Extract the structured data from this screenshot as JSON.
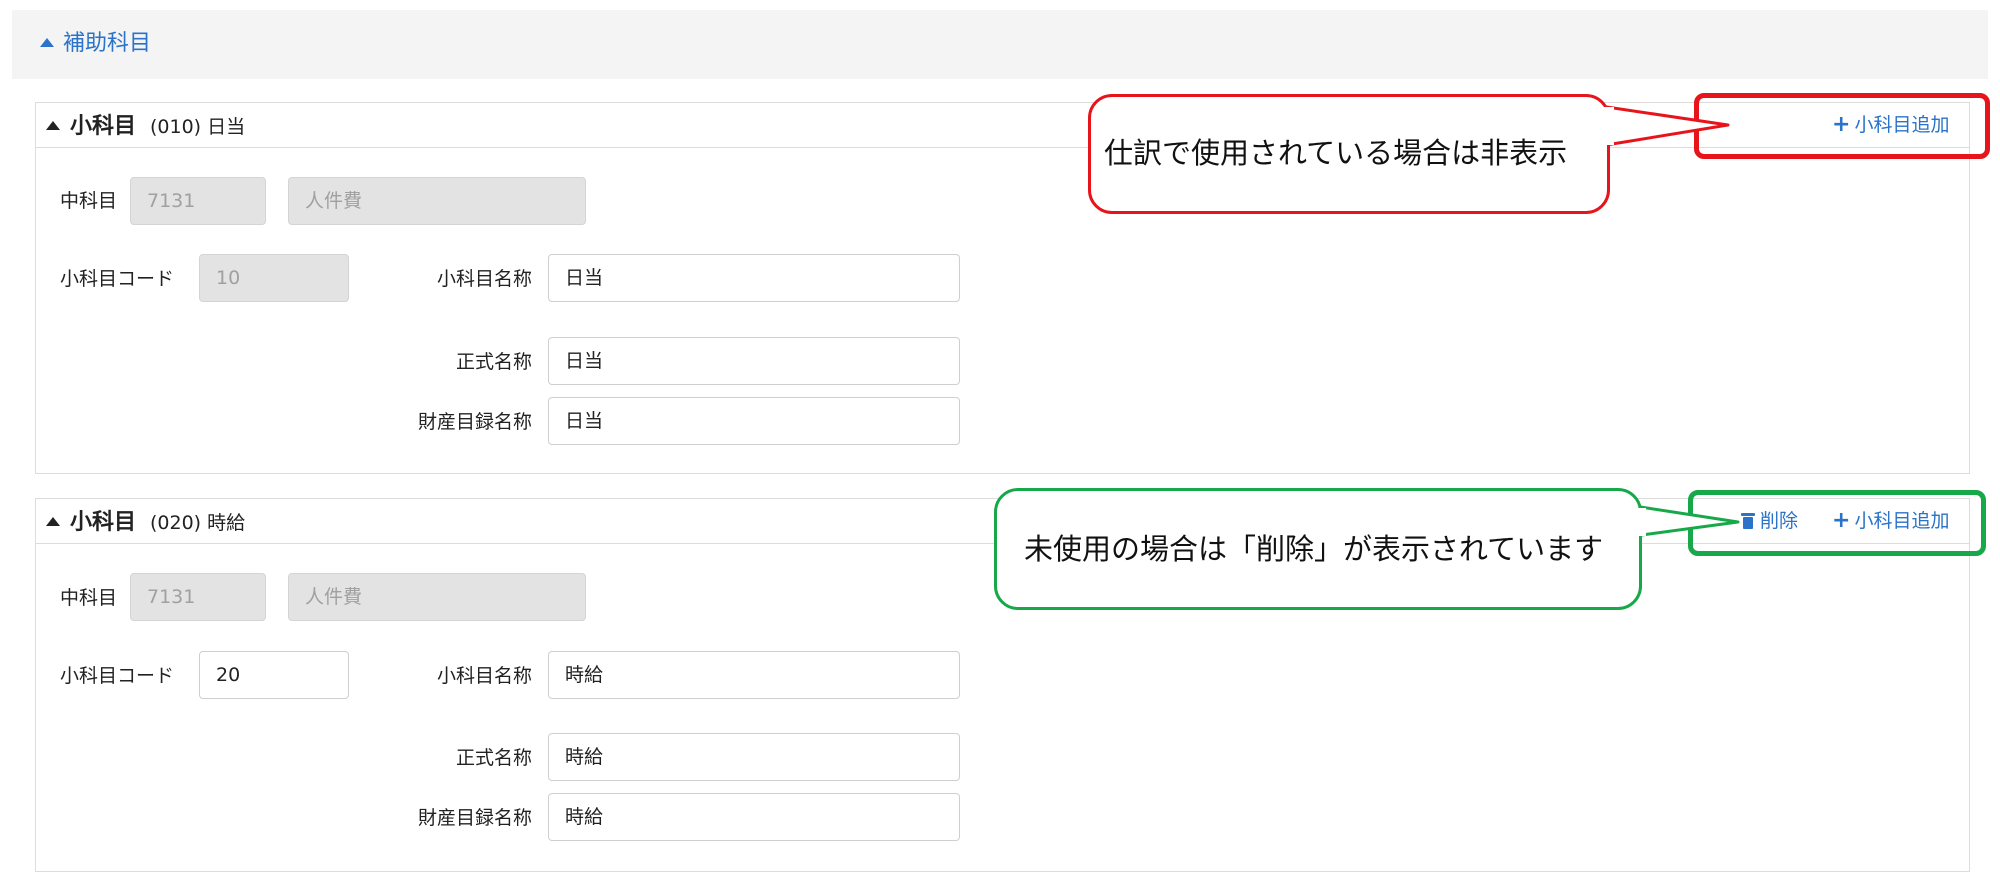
{
  "section": {
    "title": "補助科目"
  },
  "panels": [
    {
      "title": "小科目",
      "subtitle": "(010) 日当",
      "add_label": "小科目追加",
      "fields": {
        "chu_label": "中科目",
        "chu_code": "7131",
        "chu_name": "人件費",
        "code_label": "小科目コード",
        "code_value": "10",
        "name_label": "小科目名称",
        "name_value": "日当",
        "formal_label": "正式名称",
        "formal_value": "日当",
        "asset_label": "財産目録名称",
        "asset_value": "日当"
      }
    },
    {
      "title": "小科目",
      "subtitle": "(020) 時給",
      "delete_label": "削除",
      "add_label": "小科目追加",
      "fields": {
        "chu_label": "中科目",
        "chu_code": "7131",
        "chu_name": "人件費",
        "code_label": "小科目コード",
        "code_value": "20",
        "name_label": "小科目名称",
        "name_value": "時給",
        "formal_label": "正式名称",
        "formal_value": "時給",
        "asset_label": "財産目録名称",
        "asset_value": "時給"
      }
    }
  ],
  "callouts": [
    {
      "text": "仕訳で使用されている場合は非表示",
      "color": "#e8141b"
    },
    {
      "text": "未使用の場合は「削除」が表示されています",
      "color": "#17a84a"
    }
  ],
  "colors": {
    "accent": "#2a73c8"
  }
}
